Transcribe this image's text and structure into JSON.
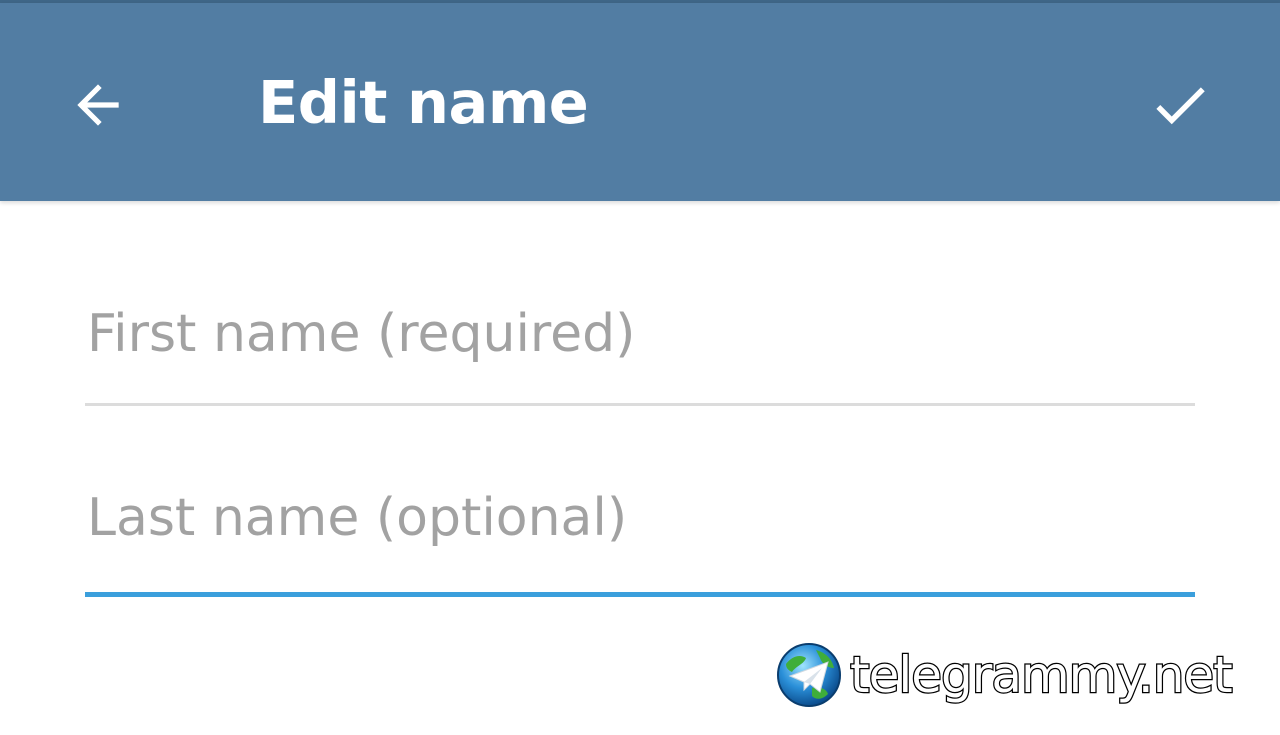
{
  "app_bar": {
    "title": "Edit name",
    "background_color": "#527da3",
    "back_icon": "arrow-left-icon",
    "done_icon": "checkmark-icon"
  },
  "form": {
    "first_name": {
      "value": "",
      "placeholder": "First name (required)"
    },
    "last_name": {
      "value": "",
      "placeholder": "Last name (optional)",
      "focused": true,
      "accent_color": "#3b9fdc"
    }
  },
  "watermark": {
    "text": "telegrammy.net",
    "logo_icon": "telegram-globe-logo"
  }
}
